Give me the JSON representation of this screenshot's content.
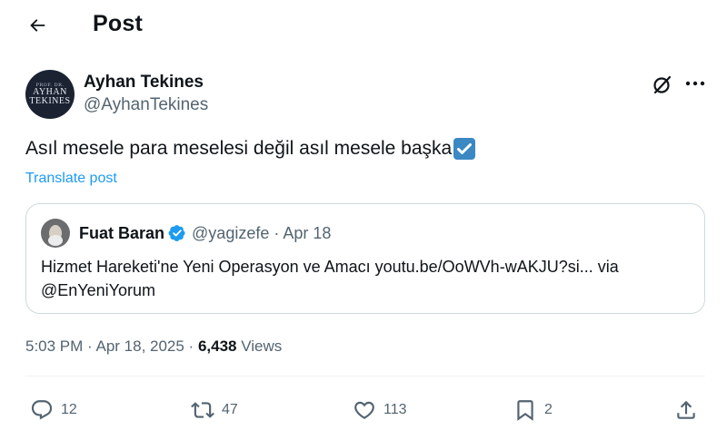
{
  "header": {
    "title": "Post",
    "back_icon": "arrow-left-icon"
  },
  "author": {
    "display_name": "Ayhan Tekines",
    "handle": "@AyhanTekines",
    "avatar_top": "PROF. DR.",
    "avatar_line1": "AYHAN",
    "avatar_line2": "TEKINES"
  },
  "post": {
    "text": "Asıl mesele para meselesi değil asıl mesele başka",
    "emoji": "check-mark-button",
    "translate_label": "Translate post"
  },
  "quote": {
    "display_name": "Fuat Baran",
    "handle_date": "@yagizefe · Apr 18",
    "body": "Hizmet Hareketi'ne Yeni Operasyon ve Amacı youtu.be/OoWVh-wAKJU?si... via @EnYeniYorum"
  },
  "meta": {
    "time_date": "5:03 PM · Apr 18, 2025 · ",
    "views_count": "6,438",
    "views_label": " Views"
  },
  "actions": {
    "replies": "12",
    "reposts": "47",
    "likes": "113",
    "bookmarks": "2"
  },
  "colors": {
    "accent": "#1d9bf0",
    "text": "#0f1419",
    "muted": "#536471",
    "border": "#cfd9de"
  }
}
